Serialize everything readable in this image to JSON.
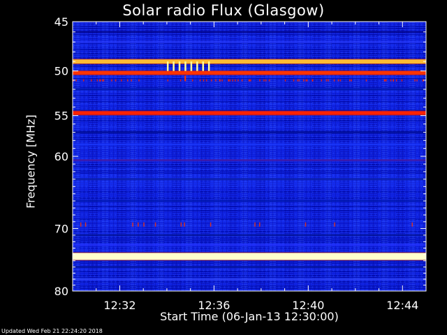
{
  "page": {
    "title": "Solar radio Flux (Glasgow)",
    "updated": "Updated Wed Feb 21 22:24:20 2018"
  },
  "colors": {
    "background": "#000000",
    "spectrogram_base": "#0a1ad6",
    "strong_band": "#ffffcc",
    "orange_band": "#ff9900",
    "red_band": "#ff2200",
    "axes": "#ffffff"
  },
  "chart_data": {
    "type": "heatmap",
    "title": "Solar radio Flux (Glasgow)",
    "xlabel": "Start Time (06-Jan-13 12:30:00)",
    "ylabel": "Frequency [MHz]",
    "x_unit": "time (HH:MM, 06-Jan-13)",
    "xlim": [
      "12:30:00",
      "12:45:00"
    ],
    "ylim": [
      45,
      80
    ],
    "y_inverted": true,
    "y_scale": "log",
    "x_ticks": [
      "12:32",
      "12:36",
      "12:40",
      "12:44"
    ],
    "y_ticks": [
      45,
      50,
      55,
      60,
      70,
      80
    ],
    "colormap": "black-blue-red-yellow-white",
    "features": [
      {
        "type": "continuous_band",
        "freq_mhz": 49.0,
        "color": "#ffbb33"
      },
      {
        "type": "continuous_band",
        "freq_mhz": 50.2,
        "color": "#ff3300"
      },
      {
        "type": "continuous_band",
        "freq_mhz": 54.7,
        "color": "#ff2200"
      },
      {
        "type": "continuous_band",
        "freq_mhz": 74.3,
        "color": "#ffffcc"
      },
      {
        "type": "burst_group",
        "start_time": "12:34",
        "end_time": "12:35:45",
        "freq_range": [
          49,
          50
        ],
        "color": "#ffff99"
      }
    ]
  }
}
